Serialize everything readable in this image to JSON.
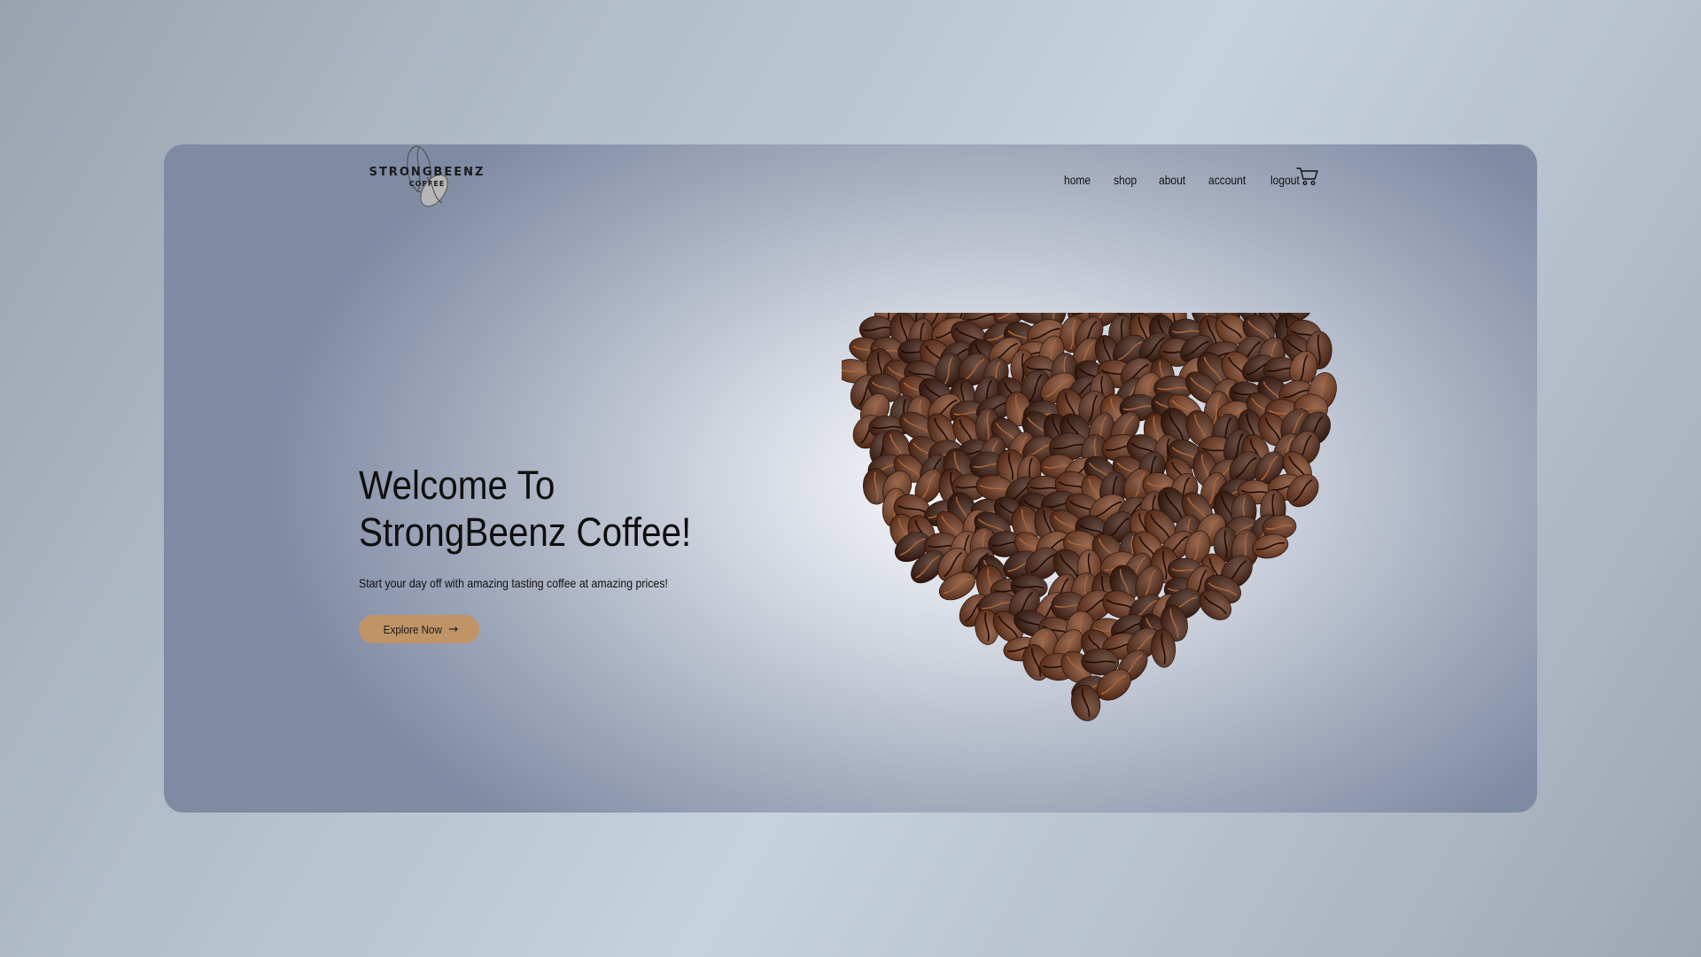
{
  "brand": {
    "name": "STRONGBEENZ",
    "tagline": "COFFEE",
    "logo_icon": "coffee-bean-icon"
  },
  "nav": {
    "items": [
      {
        "label": "home"
      },
      {
        "label": "shop"
      },
      {
        "label": "about"
      },
      {
        "label": "account"
      },
      {
        "label": "logout"
      }
    ],
    "cart_icon": "shopping-cart-icon"
  },
  "hero": {
    "title_line1": "Welcome To",
    "title_line2": "StrongBeenz Coffee!",
    "subtitle": "Start your day off with amazing tasting coffee at amazing prices!",
    "cta_label": "Explore Now",
    "cta_icon": "arrow-right-icon",
    "image": "coffee-beans-heart"
  },
  "colors": {
    "accent": "#c09467",
    "bean_dark": "#3b1a0e",
    "bean_mid": "#5b2c18",
    "bean_light": "#7a3f22"
  }
}
